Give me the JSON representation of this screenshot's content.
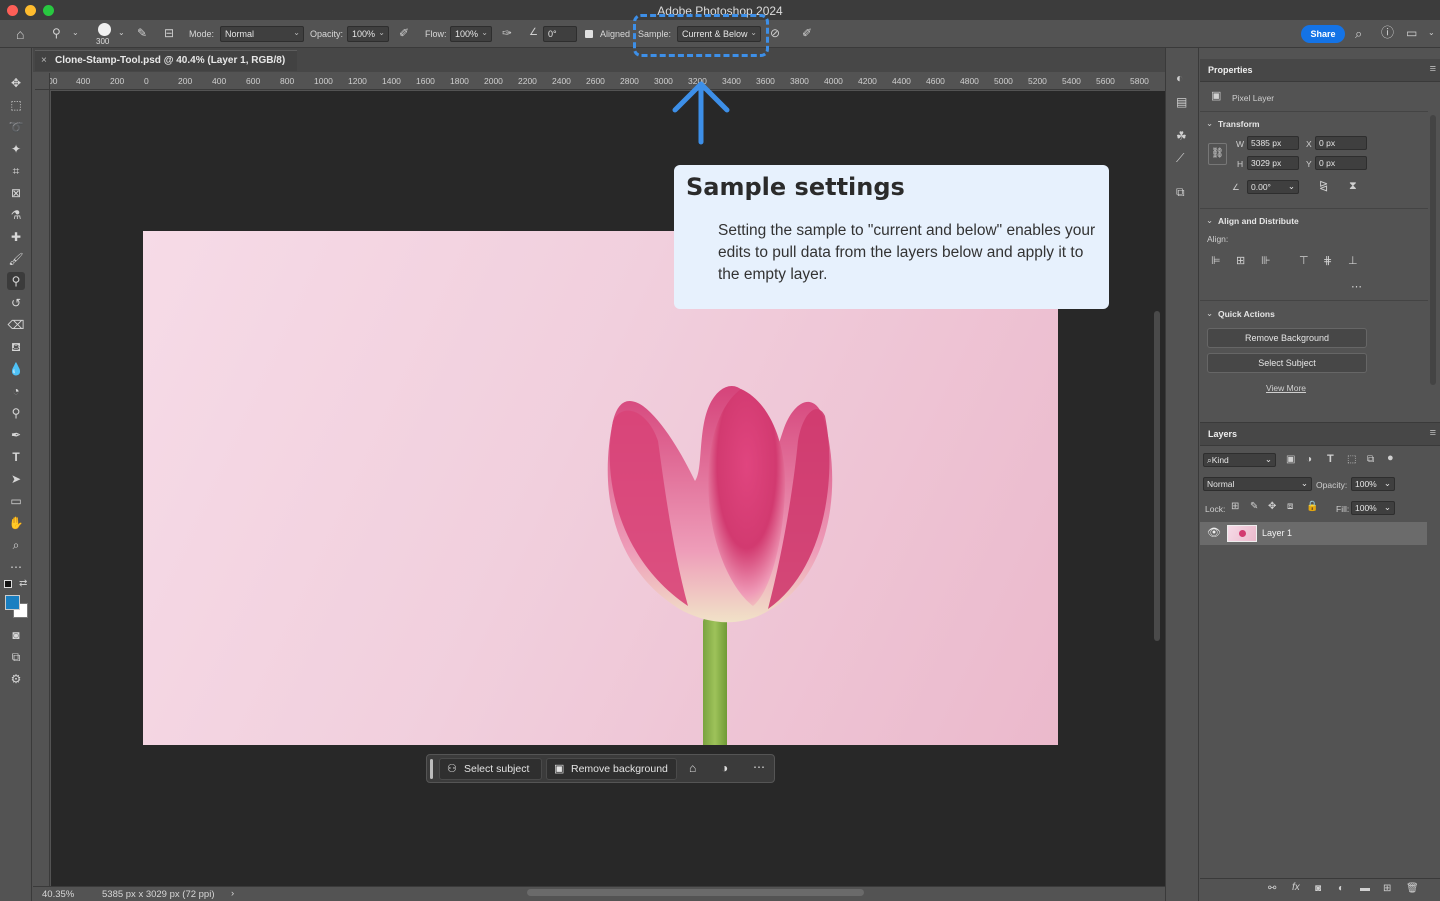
{
  "window": {
    "title": "Adobe Photoshop 2024"
  },
  "options_bar": {
    "brush_size": "300",
    "mode_label": "Mode:",
    "mode_value": "Normal",
    "opacity_label": "Opacity:",
    "opacity_value": "100%",
    "flow_label": "Flow:",
    "flow_value": "100%",
    "angle_value": "0°",
    "aligned_label": "Aligned",
    "sample_label": "Sample:",
    "sample_value": "Current & Below",
    "share_label": "Share"
  },
  "document": {
    "tab_title": "Clone-Stamp-Tool.psd @ 40.4% (Layer 1, RGB/8)",
    "ruler_ticks": [
      "00",
      "400",
      "200",
      "0",
      "200",
      "400",
      "600",
      "800",
      "1000",
      "1200",
      "1400",
      "1600",
      "1800",
      "2000",
      "2200",
      "2400",
      "2600",
      "2800",
      "3000",
      "3200",
      "3400",
      "3600",
      "3800",
      "4000",
      "4200",
      "4400",
      "4600",
      "4800",
      "5000",
      "5200",
      "5400",
      "5600",
      "5800"
    ],
    "zoom": "40.35%",
    "doc_info": "5385 px x 3029 px (72 ppi)"
  },
  "taskbar": {
    "select_subject": "Select subject",
    "remove_background": "Remove background"
  },
  "callout": {
    "title": "Sample settings",
    "body": "Setting the sample to \"current and below\" enables your edits to pull data from the layers below and apply it to the empty layer."
  },
  "properties": {
    "title": "Properties",
    "layer_type": "Pixel Layer",
    "transform_title": "Transform",
    "w_label": "W",
    "w_value": "5385 px",
    "h_label": "H",
    "h_value": "3029 px",
    "x_label": "X",
    "x_value": "0 px",
    "y_label": "Y",
    "y_value": "0 px",
    "angle_value": "0.00°",
    "align_title": "Align and Distribute",
    "align_label": "Align:",
    "quick_actions_title": "Quick Actions",
    "remove_background": "Remove Background",
    "select_subject": "Select Subject",
    "view_more": "View More"
  },
  "layers": {
    "title": "Layers",
    "filter_kind": "Kind",
    "blend_mode": "Normal",
    "opacity_label": "Opacity:",
    "opacity_value": "100%",
    "lock_label": "Lock:",
    "fill_label": "Fill:",
    "fill_value": "100%",
    "items": [
      {
        "name": "Layer 1"
      }
    ]
  },
  "colors": {
    "accent": "#1473e6",
    "annotation": "#3d8fe8",
    "callout_bg": "#e7f1fd",
    "foreground_swatch": "#1a7fc1"
  }
}
